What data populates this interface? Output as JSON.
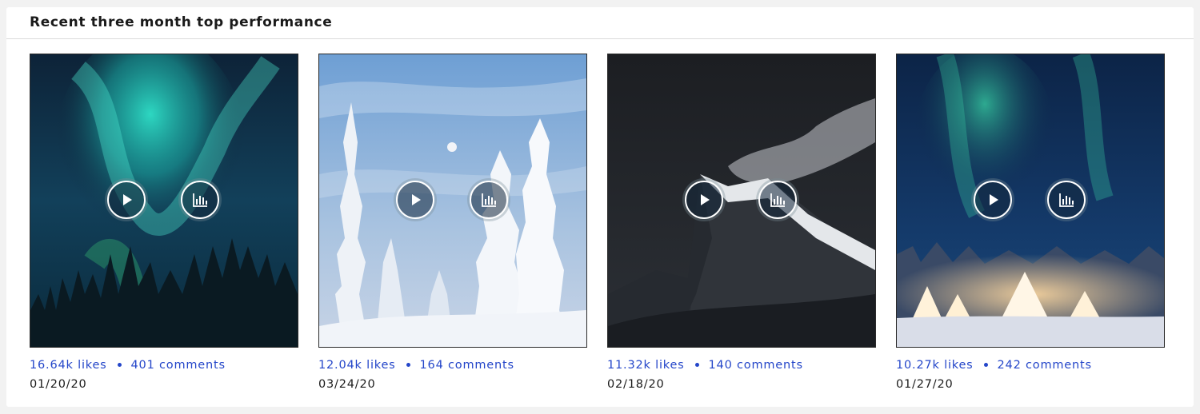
{
  "section": {
    "title": "Recent three month top performance"
  },
  "posts": [
    {
      "image": "aurora-forest-photo",
      "likes": "16.64k likes",
      "comments": "401 comments",
      "date": "01/20/20"
    },
    {
      "image": "snowy-trees-moon-photo",
      "likes": "12.04k likes",
      "comments": "164 comments",
      "date": "03/24/20"
    },
    {
      "image": "snowy-mountain-clouds-photo",
      "likes": "11.32k likes",
      "comments": "140 comments",
      "date": "02/18/20"
    },
    {
      "image": "aurora-tipis-photo",
      "likes": "10.27k likes",
      "comments": "242 comments",
      "date": "01/27/20"
    }
  ],
  "icons": {
    "play": "play-icon",
    "stats": "bar-chart-icon"
  },
  "colors": {
    "link": "#2446c9",
    "text": "#1a1a1a",
    "panel": "#ffffff",
    "background": "#f2f2f2"
  }
}
